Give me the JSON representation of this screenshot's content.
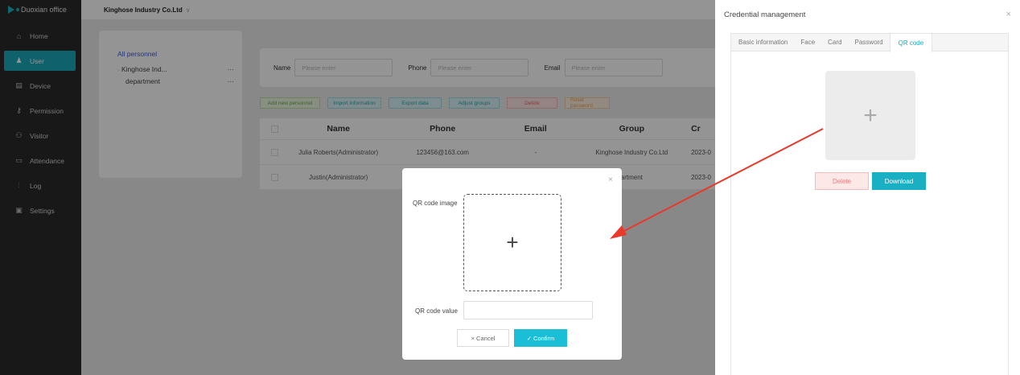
{
  "app": {
    "logo_text": "Duoxian office",
    "company": "Kinghose Industry Co.Ltd",
    "caret": "∨"
  },
  "sidebar": {
    "items": [
      {
        "label": "Home",
        "icon": "home-icon",
        "glyph": "⌂"
      },
      {
        "label": "User",
        "icon": "user-icon",
        "glyph": "♟"
      },
      {
        "label": "Device",
        "icon": "device-icon",
        "glyph": "▤"
      },
      {
        "label": "Permission",
        "icon": "permission-icon",
        "glyph": "⚷"
      },
      {
        "label": "Visitor",
        "icon": "visitor-icon",
        "glyph": "⚇"
      },
      {
        "label": "Attendance",
        "icon": "attendance-icon",
        "glyph": "▭"
      },
      {
        "label": "Log",
        "icon": "log-icon",
        "glyph": "⫶"
      },
      {
        "label": "Settings",
        "icon": "settings-icon",
        "glyph": "▣"
      }
    ],
    "active_index": 1
  },
  "org": {
    "all_label": "All personnel",
    "nodes": [
      {
        "label": "Kinghose Ind...",
        "more": "···"
      },
      {
        "label": "department",
        "more": "···"
      }
    ]
  },
  "filter": {
    "name_label": "Name",
    "name_placeholder": "Please enter",
    "phone_label": "Phone",
    "phone_placeholder": "Please enter",
    "email_label": "Email",
    "email_placeholder": "Please enter"
  },
  "actions": {
    "add": "Add new personnel",
    "import": "Import information",
    "export": "Export data",
    "adjust": "Adjust groups",
    "delete": "Delete",
    "reset": "Reset password"
  },
  "table": {
    "headers": {
      "name": "Name",
      "phone": "Phone",
      "email": "Email",
      "group": "Group",
      "created": "Cr"
    },
    "rows": [
      {
        "name": "Julia Roberts(Administrator)",
        "phone": "123456@163.com",
        "email": "-",
        "group": "Kinghose Industry Co.Ltd",
        "created": "2023-0"
      },
      {
        "name": "Justin(Administrator)",
        "phone": "",
        "email": "",
        "group": "artment",
        "created": "2023-0"
      }
    ]
  },
  "drawer": {
    "title": "Credential management",
    "close": "×",
    "tabs": [
      "Basic information",
      "Face",
      "Card",
      "Password",
      "QR code"
    ],
    "active_tab": 4,
    "plus": "+",
    "delete": "Delete",
    "download": "Download"
  },
  "dialog": {
    "close": "×",
    "qr_image_label": "QR code image",
    "plus": "+",
    "qr_value_label": "QR code value",
    "qr_value": "",
    "cancel": "× Cancel",
    "confirm": "✓ Confirm"
  },
  "annotation": {
    "arrow_color": "#e8392a"
  },
  "colors": {
    "accent": "#1ab0c3",
    "sidebar_bg": "#2a2a2a"
  }
}
